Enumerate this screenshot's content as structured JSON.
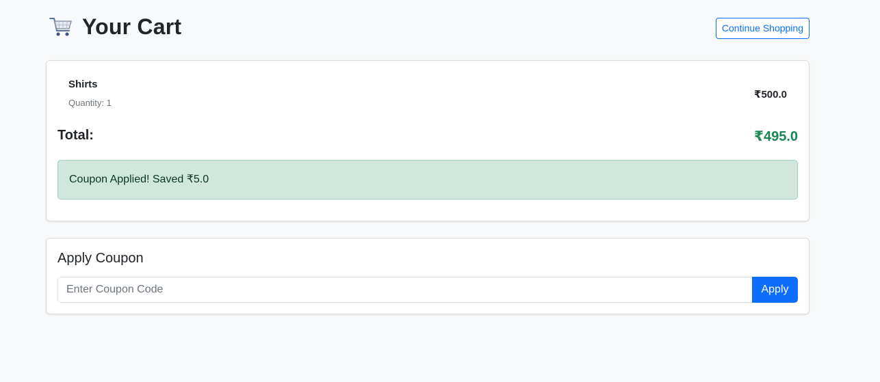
{
  "header": {
    "title": "Your Cart",
    "icon": "shopping-cart-icon",
    "continue_label": "Continue Shopping"
  },
  "cart": {
    "items": [
      {
        "name": "Shirts",
        "quantity_text": "Quantity: 1",
        "price": "₹500.0"
      }
    ],
    "total_label": "Total:",
    "total_value": "₹495.0",
    "coupon_message": "Coupon Applied! Saved ₹5.0"
  },
  "coupon": {
    "heading": "Apply Coupon",
    "placeholder": "Enter Coupon Code",
    "value": "",
    "apply_label": "Apply"
  },
  "colors": {
    "primary": "#0d6efd",
    "success": "#198754",
    "alert_bg": "#d1e7dd",
    "page_bg": "#f8f9fa"
  }
}
